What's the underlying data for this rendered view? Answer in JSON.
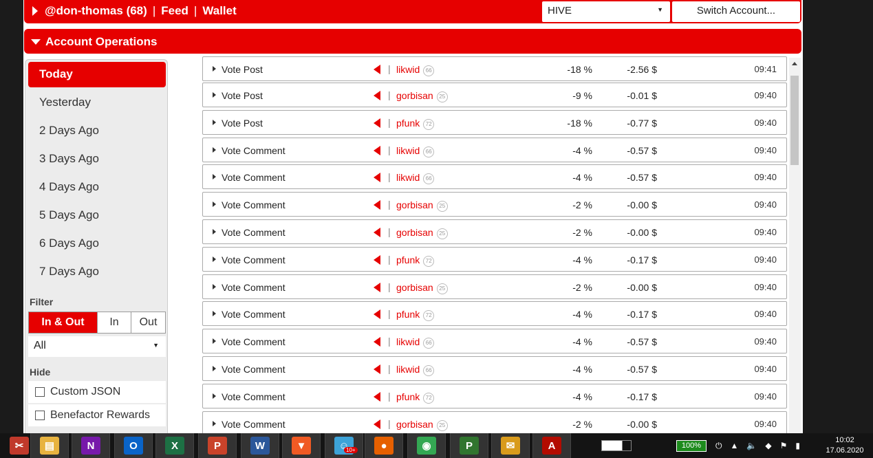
{
  "header": {
    "user_label": "@don-thomas (68)",
    "sep": "|",
    "feed_label": "Feed",
    "wallet_label": "Wallet",
    "chain_value": "HIVE",
    "switch_label": "Switch Account..."
  },
  "operations": {
    "title": "Account Operations"
  },
  "sidebar": {
    "days": [
      "Today",
      "Yesterday",
      "2 Days Ago",
      "3 Days Ago",
      "4 Days Ago",
      "5 Days Ago",
      "6 Days Ago",
      "7 Days Ago"
    ],
    "filter_label": "Filter",
    "direction": [
      "In & Out",
      "In",
      "Out"
    ],
    "type_value": "All",
    "hide_label": "Hide",
    "hide_options": [
      "Custom JSON",
      "Benefactor Rewards"
    ]
  },
  "rows": [
    {
      "op": "Vote Post",
      "user": "likwid",
      "rep": "66",
      "pct": "-18 %",
      "usd": "-2.56 $",
      "time": "09:41"
    },
    {
      "op": "Vote Post",
      "user": "gorbisan",
      "rep": "25",
      "pct": "-9 %",
      "usd": "-0.01 $",
      "time": "09:40"
    },
    {
      "op": "Vote Post",
      "user": "pfunk",
      "rep": "72",
      "pct": "-18 %",
      "usd": "-0.77 $",
      "time": "09:40"
    },
    {
      "op": "Vote Comment",
      "user": "likwid",
      "rep": "66",
      "pct": "-4 %",
      "usd": "-0.57 $",
      "time": "09:40"
    },
    {
      "op": "Vote Comment",
      "user": "likwid",
      "rep": "66",
      "pct": "-4 %",
      "usd": "-0.57 $",
      "time": "09:40"
    },
    {
      "op": "Vote Comment",
      "user": "gorbisan",
      "rep": "25",
      "pct": "-2 %",
      "usd": "-0.00 $",
      "time": "09:40"
    },
    {
      "op": "Vote Comment",
      "user": "gorbisan",
      "rep": "25",
      "pct": "-2 %",
      "usd": "-0.00 $",
      "time": "09:40"
    },
    {
      "op": "Vote Comment",
      "user": "pfunk",
      "rep": "72",
      "pct": "-4 %",
      "usd": "-0.17 $",
      "time": "09:40"
    },
    {
      "op": "Vote Comment",
      "user": "gorbisan",
      "rep": "25",
      "pct": "-2 %",
      "usd": "-0.00 $",
      "time": "09:40"
    },
    {
      "op": "Vote Comment",
      "user": "pfunk",
      "rep": "72",
      "pct": "-4 %",
      "usd": "-0.17 $",
      "time": "09:40"
    },
    {
      "op": "Vote Comment",
      "user": "likwid",
      "rep": "66",
      "pct": "-4 %",
      "usd": "-0.57 $",
      "time": "09:40"
    },
    {
      "op": "Vote Comment",
      "user": "likwid",
      "rep": "66",
      "pct": "-4 %",
      "usd": "-0.57 $",
      "time": "09:40"
    },
    {
      "op": "Vote Comment",
      "user": "pfunk",
      "rep": "72",
      "pct": "-4 %",
      "usd": "-0.17 $",
      "time": "09:40"
    },
    {
      "op": "Vote Comment",
      "user": "gorbisan",
      "rep": "25",
      "pct": "-2 %",
      "usd": "-0.00 $",
      "time": "09:40"
    }
  ],
  "taskbar": {
    "apps": [
      {
        "name": "snipping-tool-icon",
        "glyph": "✂",
        "color": "#c0392b"
      },
      {
        "name": "file-explorer-icon",
        "glyph": "▤",
        "color": "#e8b340"
      },
      {
        "name": "onenote-icon",
        "glyph": "N",
        "color": "#7719aa"
      },
      {
        "name": "outlook-icon",
        "glyph": "O",
        "color": "#0a64c8"
      },
      {
        "name": "excel-icon",
        "glyph": "X",
        "color": "#1d7044"
      },
      {
        "name": "powerpoint-icon",
        "glyph": "P",
        "color": "#c9432a"
      },
      {
        "name": "word-icon",
        "glyph": "W",
        "color": "#2b579a"
      },
      {
        "name": "brave-icon",
        "glyph": "▼",
        "color": "#f05a24"
      },
      {
        "name": "messenger-icon",
        "glyph": "☺",
        "color": "#3da3d8"
      },
      {
        "name": "firefox-icon",
        "glyph": "●",
        "color": "#e66000"
      },
      {
        "name": "chrome-icon",
        "glyph": "◉",
        "color": "#34a853"
      },
      {
        "name": "publisher-icon",
        "glyph": "P",
        "color": "#31752f"
      },
      {
        "name": "mail-icon",
        "glyph": "✉",
        "color": "#d99b1c"
      },
      {
        "name": "acrobat-icon",
        "glyph": "A",
        "color": "#b30b00"
      }
    ],
    "badge": "10+",
    "battery": "100%",
    "clock_time": "10:02",
    "clock_date": "17.06.2020"
  }
}
